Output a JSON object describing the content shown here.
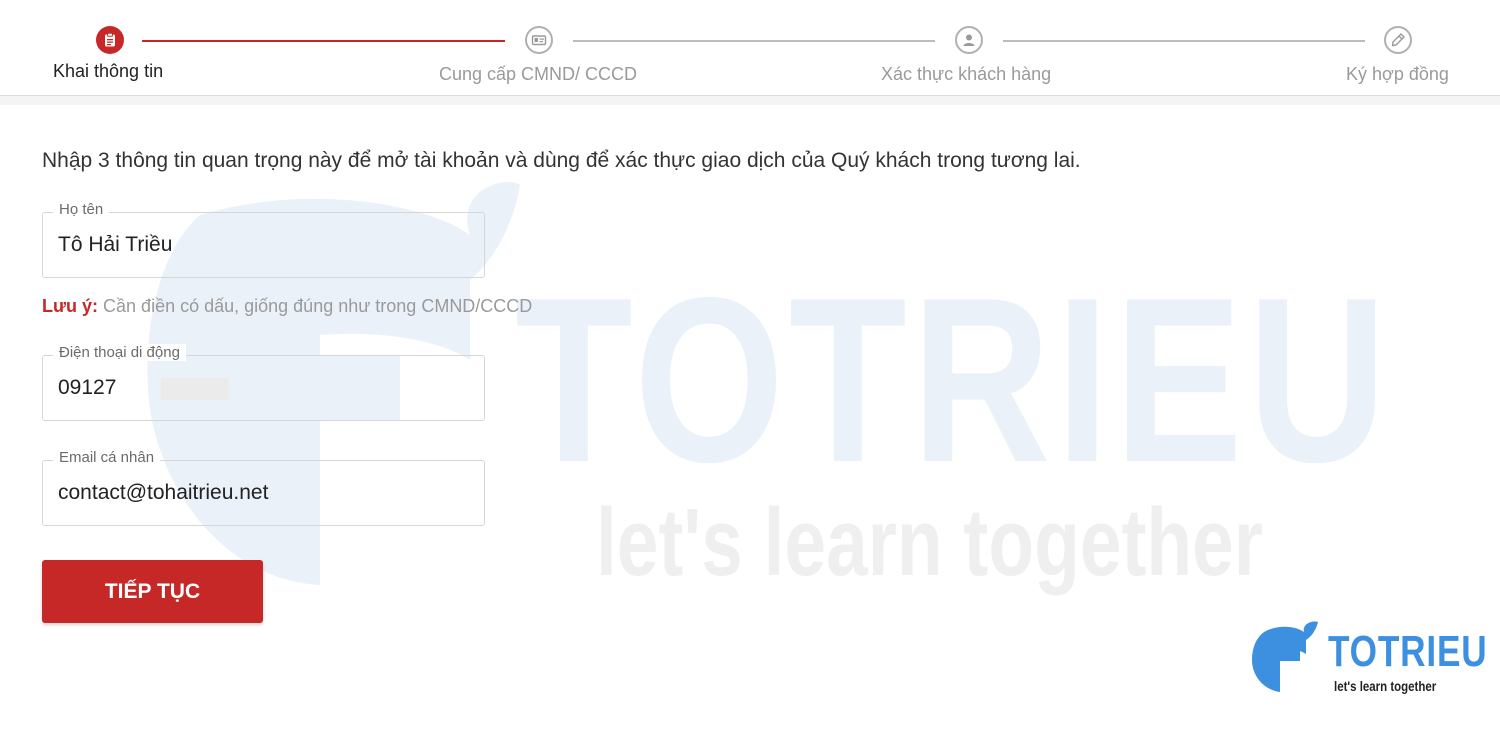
{
  "stepper": {
    "steps": [
      {
        "label": "Khai thông tin",
        "icon": "clipboard-icon",
        "state": "active"
      },
      {
        "label": "Cung cấp CMND/ CCCD",
        "icon": "id-card-icon",
        "state": "pending"
      },
      {
        "label": "Xác thực khách hàng",
        "icon": "user-icon",
        "state": "pending"
      },
      {
        "label": "Ký hợp đồng",
        "icon": "pen-icon",
        "state": "pending"
      }
    ]
  },
  "form": {
    "intro": "Nhập 3 thông tin quan trọng này để mở tài khoản và dùng để xác thực giao dịch của Quý khách trong tương lai.",
    "fullname": {
      "label": "Họ tên",
      "value": "Tô Hải Triều"
    },
    "note": {
      "strong": "Lưu ý:",
      "text": " Cần điền có dấu, giống đúng như trong CMND/CCCD"
    },
    "phone": {
      "label": "Điện thoại di động",
      "value": "09127"
    },
    "email": {
      "label": "Email cá nhân",
      "value": "contact@tohaitrieu.net"
    },
    "submit_label": "TIẾP TỤC"
  },
  "watermark": {
    "brand": "TOTRIEU",
    "tagline": "let's learn together"
  },
  "logo": {
    "brand": "TOTRIEU",
    "tagline": "let's learn together"
  },
  "colors": {
    "accent": "#c62828",
    "inactive": "#9a9a9a",
    "brand_blue": "#3d8fdf"
  }
}
